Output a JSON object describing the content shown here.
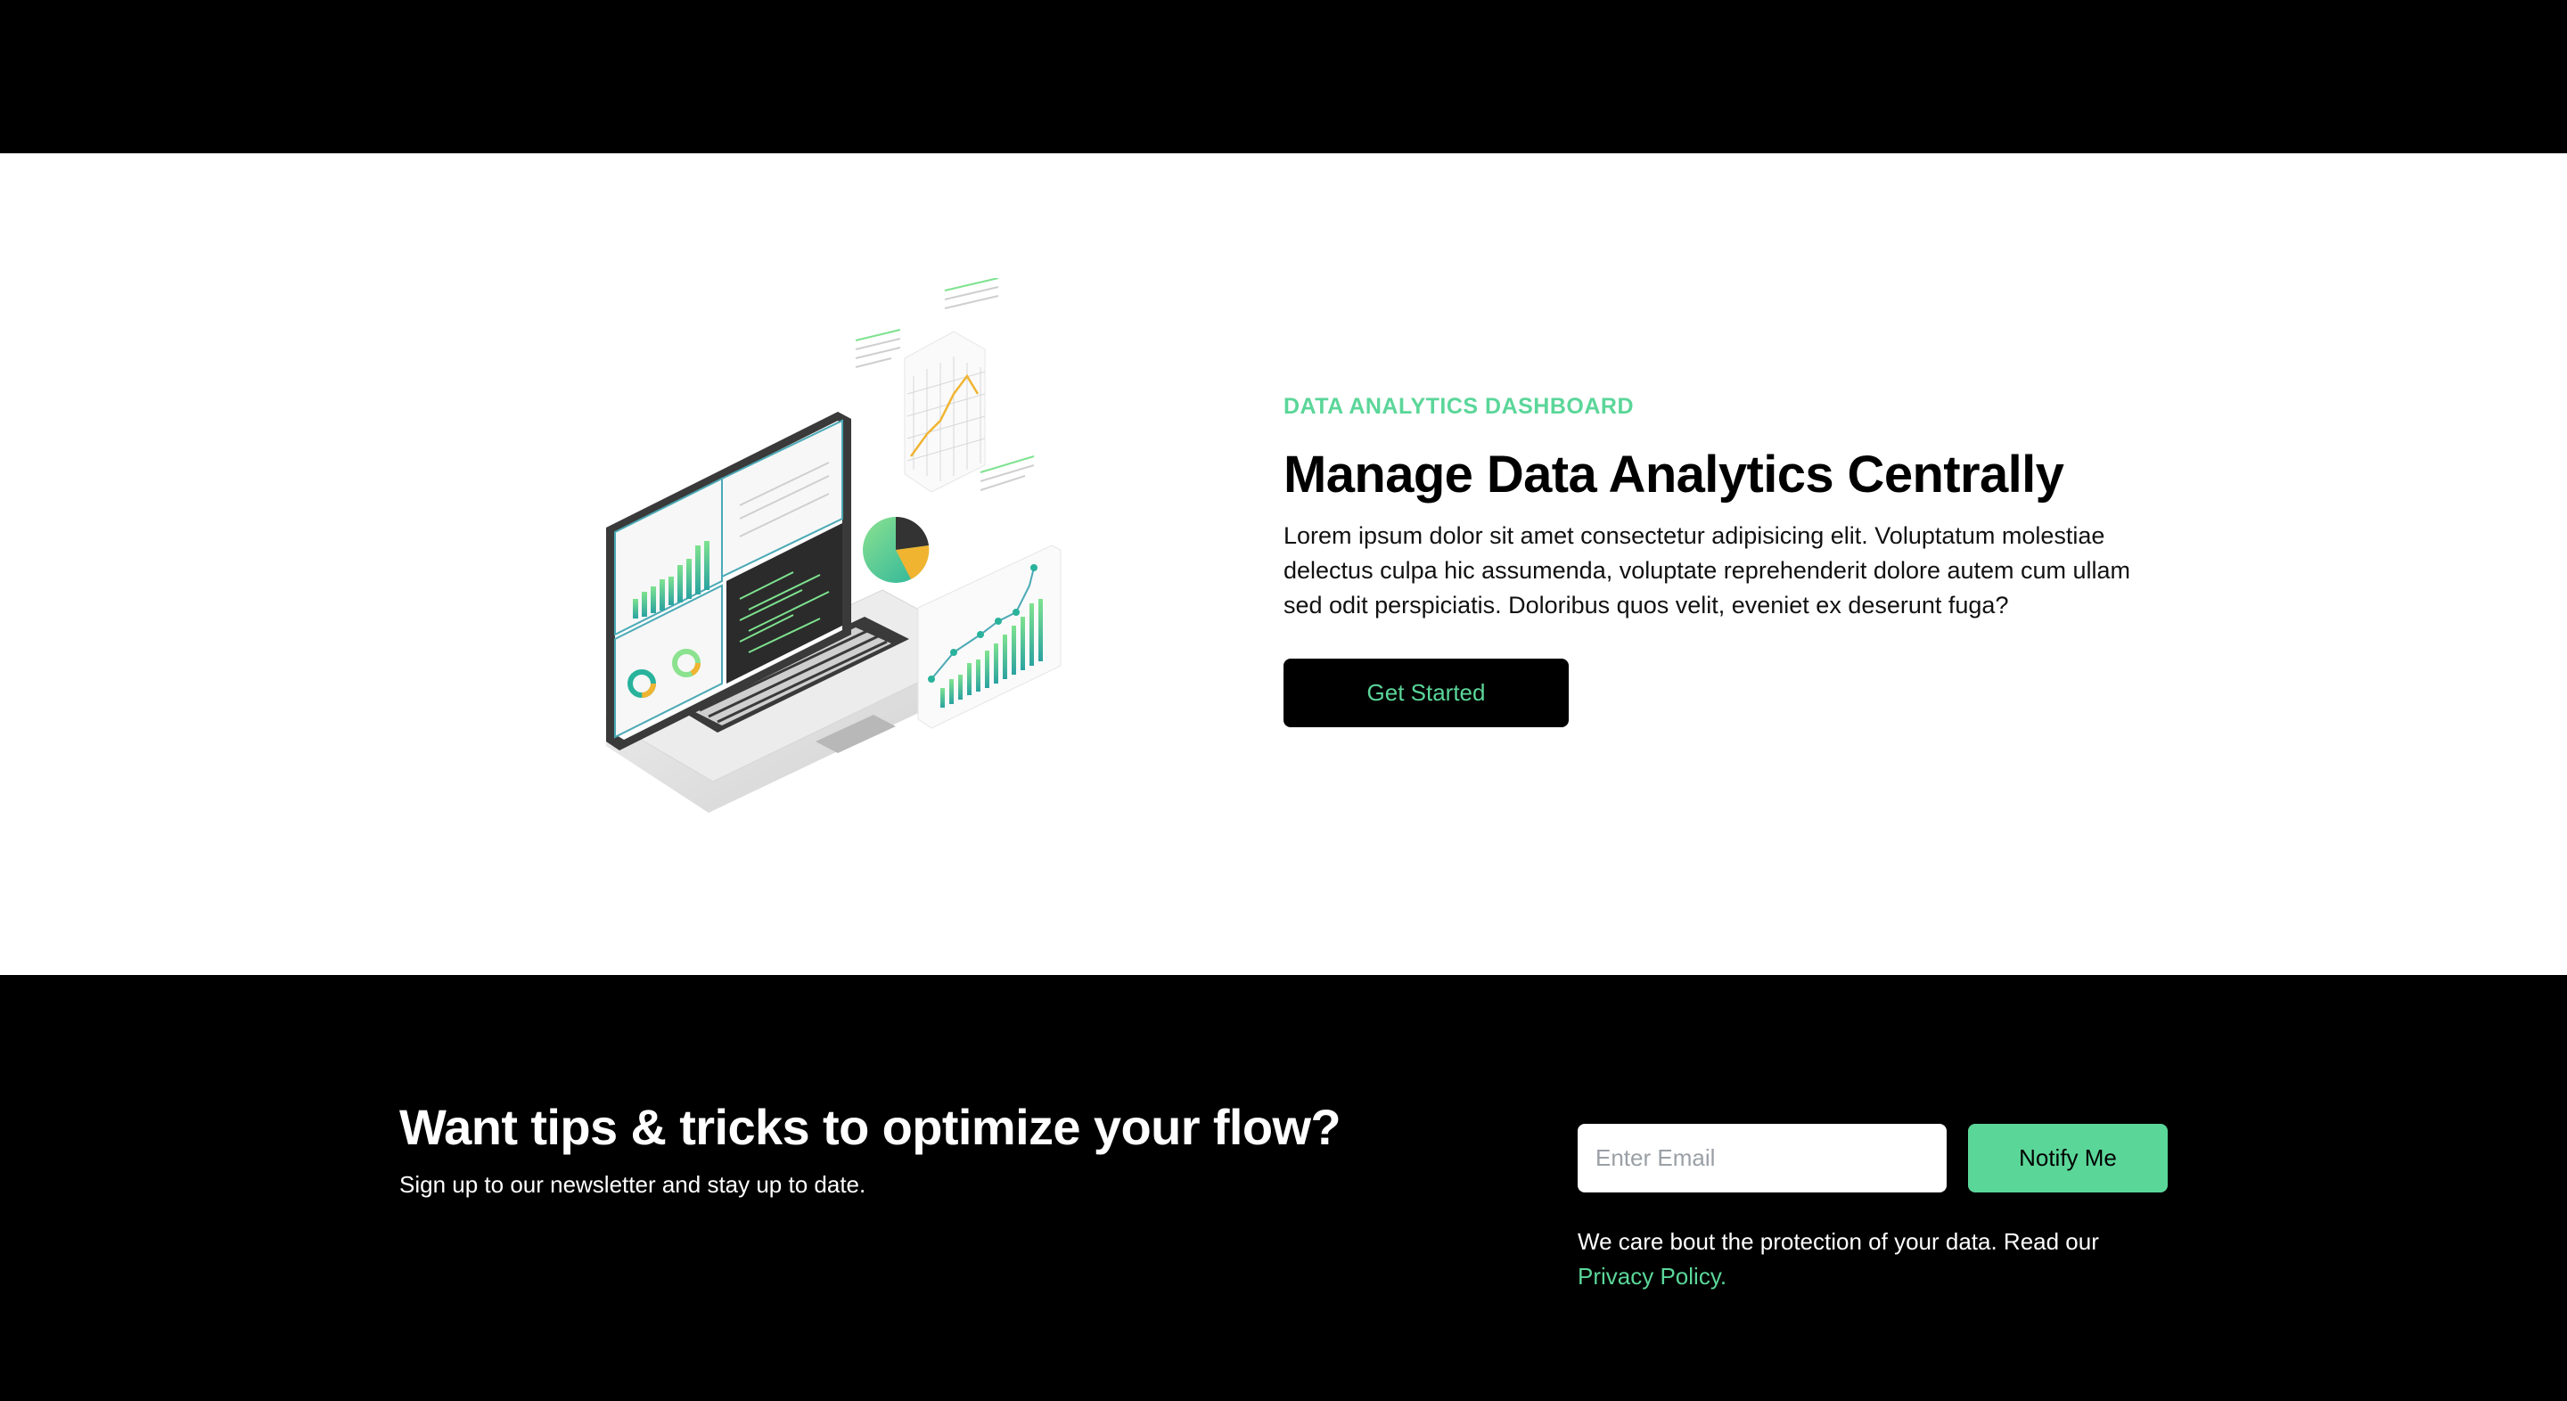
{
  "hero": {
    "eyebrow": "DATA ANALYTICS DASHBOARD",
    "title": "Manage Data Analytics Centrally",
    "description": "Lorem ipsum dolor sit amet consectetur adipisicing elit. Voluptatum molestiae delectus culpa hic assumenda, voluptate reprehenderit dolore autem cum ullam sed odit perspiciatis. Doloribus quos velit, eveniet ex deserunt fuga?",
    "cta_label": "Get Started",
    "illustration_icon": "laptop-analytics-illustration"
  },
  "newsletter": {
    "title": "Want tips & tricks to optimize your flow?",
    "subtitle": "Sign up to our newsletter and stay up to date.",
    "email_placeholder": "Enter Email",
    "email_value": "",
    "button_label": "Notify Me",
    "privacy_text": "We care bout the protection of your data. Read our",
    "privacy_link": "Privacy Policy."
  },
  "colors": {
    "accent": "#5bd699",
    "dark": "#000000",
    "light": "#ffffff"
  }
}
